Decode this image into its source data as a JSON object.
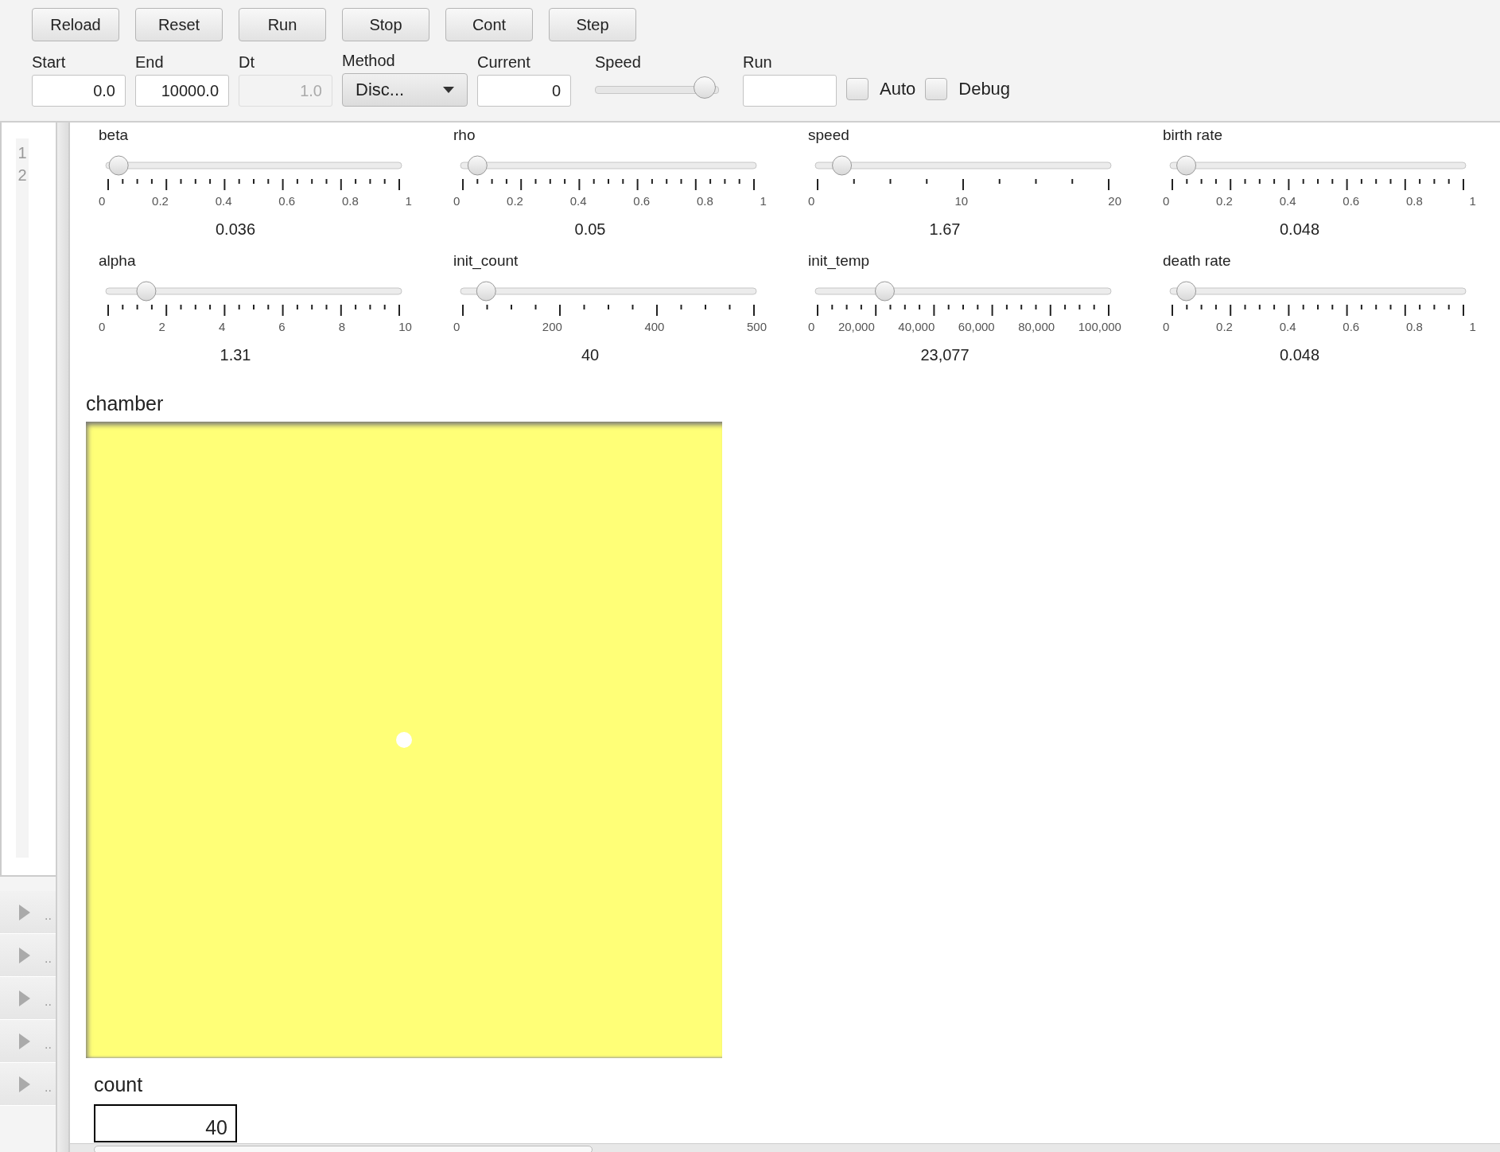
{
  "toolbar": {
    "buttons": [
      "Reload",
      "Reset",
      "Run",
      "Stop",
      "Cont",
      "Step"
    ],
    "fields": [
      {
        "kind": "text",
        "label": "Start",
        "value": "0.0",
        "disabled": false
      },
      {
        "kind": "text",
        "label": "End",
        "value": "10000.0",
        "disabled": false
      },
      {
        "kind": "text",
        "label": "Dt",
        "value": "1.0",
        "disabled": true
      },
      {
        "kind": "select",
        "label": "Method",
        "value": "Disc..."
      },
      {
        "kind": "text",
        "label": "Current",
        "value": "0",
        "disabled": false
      },
      {
        "kind": "slider",
        "label": "Speed",
        "level": 0.95
      },
      {
        "kind": "text",
        "label": "Run",
        "disabled": false
      },
      {
        "kind": "checkbox",
        "label": "Auto",
        "checked": false
      },
      {
        "kind": "checkbox",
        "label": "Debug",
        "checked": false
      }
    ]
  },
  "gutter": {
    "line_numbers": [
      "1",
      "2"
    ]
  },
  "collapsed_rows": [
    {
      "label": ".."
    },
    {
      "label": ".."
    },
    {
      "label": ".."
    },
    {
      "label": ".."
    },
    {
      "label": ".."
    }
  ],
  "sliders": [
    {
      "label": "beta",
      "level": 0.036,
      "tick_labels": [
        "0",
        "0.2",
        "0.4",
        "0.6",
        "0.8",
        "1"
      ],
      "reading": "0.036"
    },
    {
      "label": "rho",
      "level": 0.05,
      "tick_labels": [
        "0",
        "0.2",
        "0.4",
        "0.6",
        "0.8",
        "1"
      ],
      "reading": "0.05"
    },
    {
      "label": "speed",
      "level": 0.0835,
      "tick_labels": [
        "0",
        "10",
        "20"
      ],
      "reading": "1.67"
    },
    {
      "label": "birth rate",
      "level": 0.048,
      "tick_labels": [
        "0",
        "0.2",
        "0.4",
        "0.6",
        "0.8",
        "1"
      ],
      "reading": "0.048"
    },
    {
      "label": "alpha",
      "level": 0.131,
      "tick_labels": [
        "0",
        "2",
        "4",
        "6",
        "8",
        "10"
      ],
      "reading": "1.31"
    },
    {
      "label": "init_count",
      "level": 0.08,
      "tick_labels": [
        "0",
        "200",
        "400",
        "500"
      ],
      "reading": "40"
    },
    {
      "label": "init_temp",
      "level": 0.23077,
      "tick_labels": [
        "0",
        "20,000",
        "40,000",
        "60,000",
        "80,000",
        "100,000"
      ],
      "reading": "23,077"
    },
    {
      "label": "death rate",
      "level": 0.048,
      "tick_labels": [
        "0",
        "0.2",
        "0.4",
        "0.6",
        "0.8",
        "1"
      ],
      "reading": "0.048"
    }
  ],
  "chamber": {
    "title": "chamber"
  },
  "count": {
    "label": "count",
    "value": "40"
  }
}
